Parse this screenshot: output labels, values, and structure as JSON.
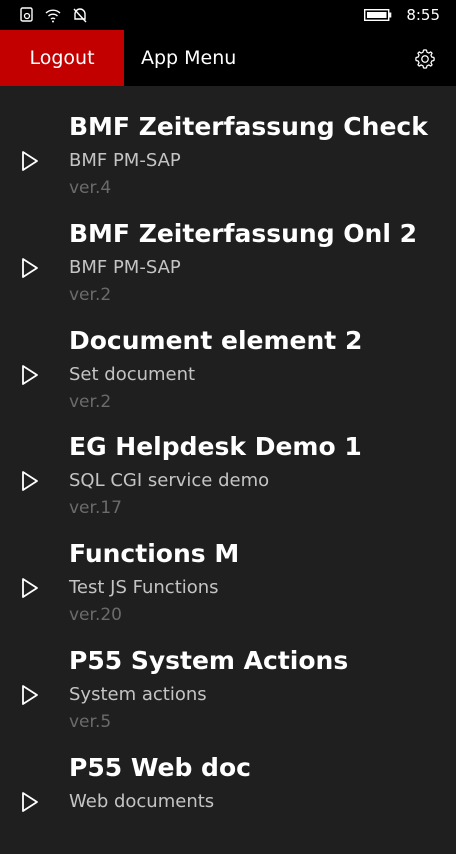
{
  "status_bar": {
    "icons": [
      "camera-icon",
      "wifi-icon",
      "notification-off-icon"
    ],
    "battery_icon": "battery-icon",
    "time": "8:55"
  },
  "app_bar": {
    "logout_label": "Logout",
    "title": "App Menu",
    "settings_icon": "gear-icon",
    "accent_color": "#c20000"
  },
  "apps": [
    {
      "title": "BMF Zeiterfassung Check",
      "subtitle": "BMF PM-SAP",
      "version": "ver.4"
    },
    {
      "title": "BMF Zeiterfassung Onl 2",
      "subtitle": "BMF PM-SAP",
      "version": "ver.2"
    },
    {
      "title": "Document element 2",
      "subtitle": "Set document",
      "version": "ver.2"
    },
    {
      "title": "EG Helpdesk Demo 1",
      "subtitle": "SQL CGI service demo",
      "version": "ver.17"
    },
    {
      "title": "Functions M",
      "subtitle": "Test JS Functions",
      "version": "ver.20"
    },
    {
      "title": "P55 System Actions",
      "subtitle": "System actions",
      "version": "ver.5"
    },
    {
      "title": "P55 Web doc",
      "subtitle": "Web documents",
      "version": ""
    }
  ]
}
